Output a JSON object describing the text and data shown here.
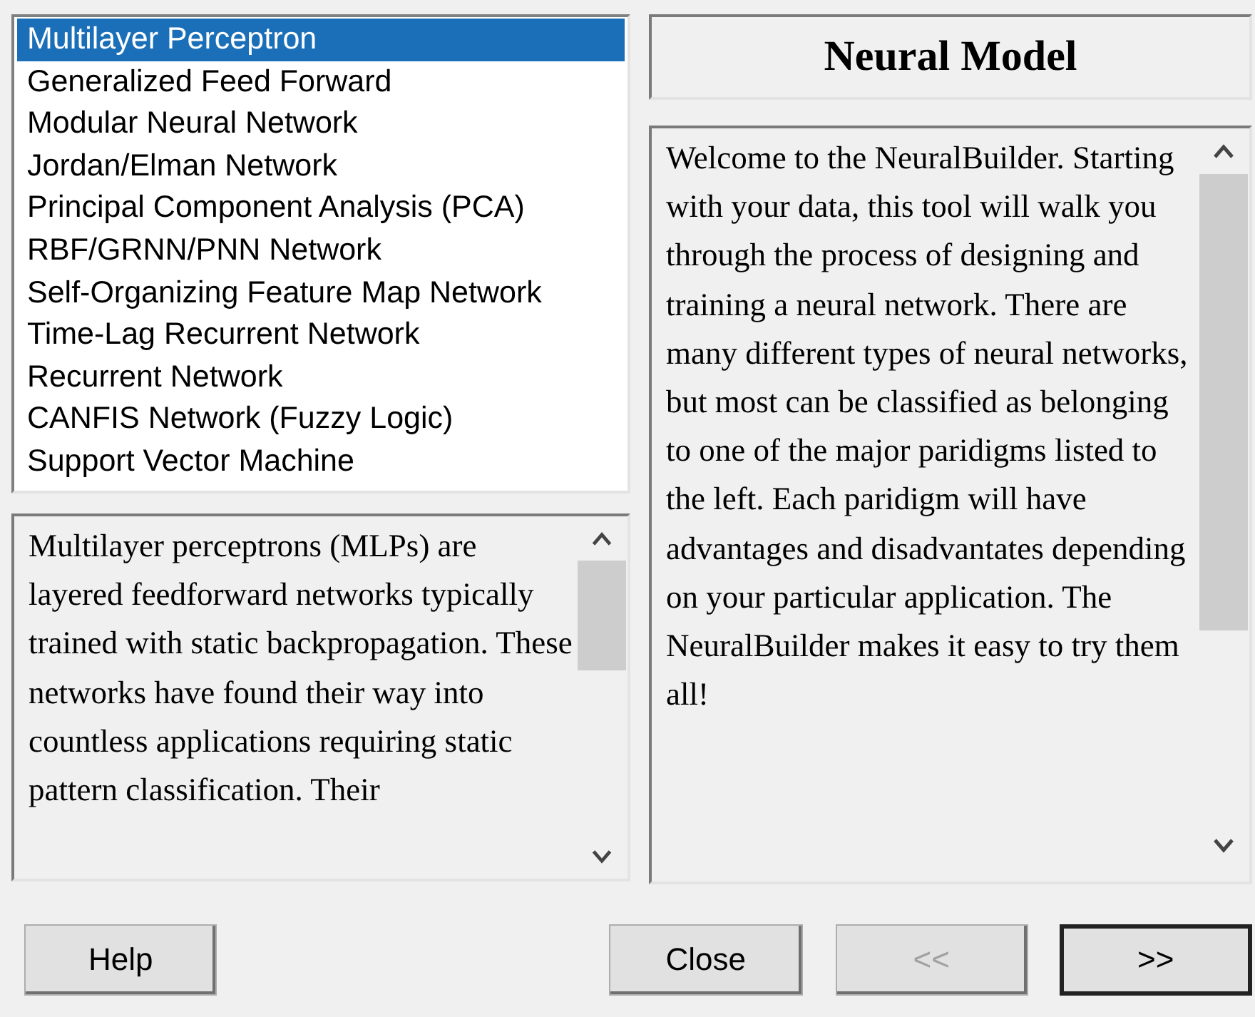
{
  "models": [
    {
      "label": "Multilayer Perceptron",
      "selected": true
    },
    {
      "label": "Generalized Feed Forward",
      "selected": false
    },
    {
      "label": "Modular Neural Network",
      "selected": false
    },
    {
      "label": "Jordan/Elman Network",
      "selected": false
    },
    {
      "label": "Principal Component Analysis (PCA)",
      "selected": false
    },
    {
      "label": "RBF/GRNN/PNN Network",
      "selected": false
    },
    {
      "label": "Self-Organizing Feature Map Network",
      "selected": false
    },
    {
      "label": "Time-Lag Recurrent Network",
      "selected": false
    },
    {
      "label": "Recurrent Network",
      "selected": false
    },
    {
      "label": "CANFIS Network (Fuzzy Logic)",
      "selected": false
    },
    {
      "label": "Support Vector Machine",
      "selected": false
    }
  ],
  "model_description": "Multilayer perceptrons (MLPs) are layered feedforward networks typically trained with static backpropagation. These networks have found their way into countless applications requiring static pattern classification. Their",
  "title": "Neural Model",
  "welcome_text": "Welcome to the NeuralBuilder. Starting with your data, this tool will walk you through the process of designing and training a neural network. There are many different types of neural networks, but most can be classified as belonging to one of the major paridigms listed to the left. Each paridigm will have advantages and disadvantates depending on your particular application. The NeuralBuilder makes it easy to try them all!",
  "buttons": [
    {
      "kind": "help",
      "label": "Help",
      "disabled": false,
      "default": false
    },
    {
      "kind": "close",
      "label": "Close",
      "disabled": false,
      "default": false
    },
    {
      "kind": "back",
      "label": "<<",
      "disabled": true,
      "default": false
    },
    {
      "kind": "next",
      "label": ">>",
      "disabled": false,
      "default": true
    }
  ]
}
